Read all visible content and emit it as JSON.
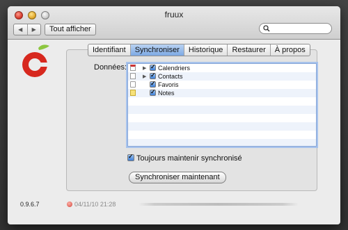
{
  "window": {
    "title": "fruux"
  },
  "toolbar": {
    "back_icon": "chevron-left-icon",
    "forward_icon": "chevron-right-icon",
    "show_all_label": "Tout afficher",
    "search_placeholder": ""
  },
  "tabs": [
    {
      "label": "Identifiant",
      "active": false
    },
    {
      "label": "Synchroniser",
      "active": true
    },
    {
      "label": "Historique",
      "active": false
    },
    {
      "label": "Restaurer",
      "active": false
    },
    {
      "label": "À propos",
      "active": false
    }
  ],
  "main": {
    "data_label": "Données:",
    "items": [
      {
        "label": "Calendriers",
        "checked": true,
        "expandable": true,
        "icon": "calendar-icon"
      },
      {
        "label": "Contacts",
        "checked": true,
        "expandable": true,
        "icon": "contacts-icon"
      },
      {
        "label": "Favoris",
        "checked": true,
        "expandable": false,
        "icon": "bookmarks-icon"
      },
      {
        "label": "Notes",
        "checked": true,
        "expandable": false,
        "icon": "notes-icon"
      }
    ],
    "always_sync_label": "Toujours maintenir synchronisé",
    "always_sync_checked": true,
    "sync_now_label": "Synchroniser maintenant"
  },
  "footer": {
    "version": "0.9.6.7",
    "last_sync": "04/11/10 21:28"
  },
  "colors": {
    "accent": "#3d7fd8",
    "tab_active": "#7da9e4",
    "logo_red": "#d7281e",
    "logo_green": "#8cc63f"
  }
}
